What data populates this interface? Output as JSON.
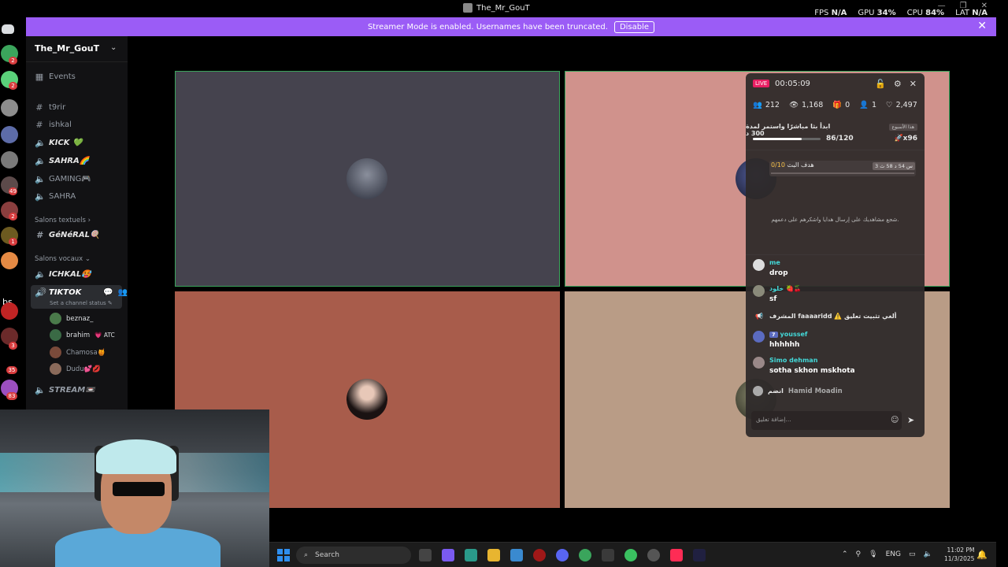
{
  "window": {
    "title": "The_Mr_GouT",
    "min": "—",
    "restore": "❐",
    "close": "✕"
  },
  "perf": {
    "fps_label": "FPS",
    "fps_value": "N/A",
    "gpu_label": "GPU",
    "gpu_value": "34%",
    "cpu_label": "CPU",
    "cpu_value": "84%",
    "lat_label": "LAT",
    "lat_value": "N/A"
  },
  "banner": {
    "text": "Streamer Mode is enabled. Usernames have been truncated.",
    "button": "Disable"
  },
  "guild_badges": [
    "2",
    "2",
    "49",
    "2",
    "1",
    "3",
    "35",
    "83"
  ],
  "guild_label": "bs",
  "server": {
    "name": "The_Mr_GouT"
  },
  "channels": {
    "events": "Events",
    "t9rir": "t9rir",
    "ishkal": "ishkal",
    "kick": "KICK 💚",
    "sahra_voice": "SAHRA🌈",
    "gaming": "GAMING🎮",
    "sahra": "SAHRA",
    "cat_text": "Salons textuels",
    "general": "GéNéRAL🍭",
    "cat_voice": "Salons vocaux",
    "ichkal": "ICHKAL🥵",
    "tiktok": "TIKTOK",
    "status_hint": "Set a channel status",
    "stream": "STREAM📼"
  },
  "voice_users": [
    {
      "name": "beznaz_"
    },
    {
      "name": "brahim",
      "tag": "💗 ATC"
    },
    {
      "name": "Chamosa🍯"
    },
    {
      "name": "Dudu💕💋"
    }
  ],
  "live_panel": {
    "live_badge": "LIVE",
    "timer": "00:05:09",
    "stats": {
      "viewers": "212",
      "views": "1,168",
      "gifts": "0",
      "followers": "1",
      "likes": "2,497"
    },
    "goal": {
      "title": "ابدأ بثا مباشرًا واستمر لمدة 300 د",
      "week": "هذا الأسبوع",
      "progress": "86/120",
      "multiplier": "x96",
      "fraction": 0.72
    },
    "bot": {
      "label": "هدف البث",
      "value": "0/10",
      "timer": "3 س 54 د 58 ث"
    },
    "encourage": "شجع مشاهديك على إرسال هدايا واشكرهم على دعمهم.",
    "messages": [
      {
        "user": "me",
        "text": "drop"
      },
      {
        "user": "خلود 🍓🍒",
        "text": "sf"
      },
      {
        "user": "youssef",
        "level": "7",
        "text": "hhhhhh"
      },
      {
        "user": "Simo dehman",
        "text": "sotha skhon mskhota"
      }
    ],
    "system_msg": "المشرف faaaaridd ⚠️ ألغي تثبيت تعليق",
    "joined": {
      "user": "Hamid Moadin",
      "action": "انضم"
    },
    "input_placeholder": "إضافة تعليق..."
  },
  "taskbar": {
    "search": "Search",
    "lang": "ENG",
    "time": "11:02 PM",
    "date": "11/3/2025"
  }
}
